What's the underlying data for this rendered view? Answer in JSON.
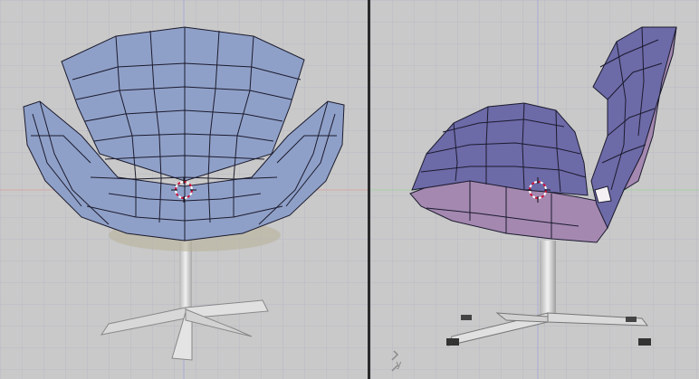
{
  "viewports": [
    {
      "view": "front",
      "axis_hint": ""
    },
    {
      "view": "side",
      "axis_hint": "y"
    }
  ],
  "colors": {
    "background": "#c9c9c9",
    "grid": "#b3b3c4",
    "mesh_front_fill": "#8fa0c8",
    "mesh_side_fill": "#6d6aa8",
    "mesh_side_underside": "#a488b0",
    "wire": "#1b1b2e",
    "cursor": "#d0103a",
    "axis_x": "#d8a0a0",
    "axis_y": "#9fd09f"
  },
  "icons": [
    "3d-cursor-icon",
    "axis-gizmo-icon"
  ]
}
